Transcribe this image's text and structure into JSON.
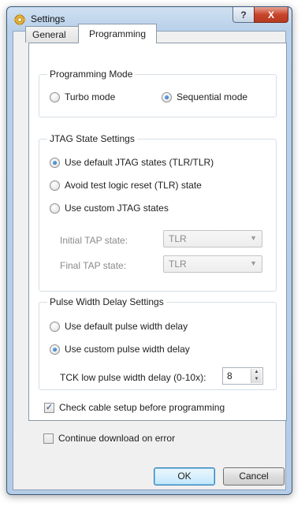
{
  "window": {
    "title": "Settings",
    "help_label": "?",
    "close_label": "X"
  },
  "tabs": [
    {
      "label": "General",
      "selected": false
    },
    {
      "label": "Programming",
      "selected": true
    }
  ],
  "programming_mode": {
    "title": "Programming Mode",
    "options": [
      {
        "label": "Turbo mode",
        "checked": false
      },
      {
        "label": "Sequential mode",
        "checked": true
      }
    ]
  },
  "jtag": {
    "title": "JTAG State Settings",
    "options": [
      {
        "label": "Use default JTAG states (TLR/TLR)",
        "checked": true
      },
      {
        "label": "Avoid test logic reset (TLR) state",
        "checked": false
      },
      {
        "label": "Use custom JTAG states",
        "checked": false
      }
    ],
    "initial_label": "Initial TAP state:",
    "initial_value": "TLR",
    "final_label": "Final TAP state:",
    "final_value": "TLR"
  },
  "pulse": {
    "title": "Pulse Width Delay Settings",
    "options": [
      {
        "label": "Use default pulse width delay",
        "checked": false
      },
      {
        "label": "Use custom pulse width delay",
        "checked": true
      }
    ],
    "tck_label": "TCK low pulse width delay (0-10x):",
    "tck_value": "8"
  },
  "checkboxes": [
    {
      "label": "Check cable setup before programming",
      "checked": true
    },
    {
      "label": "Continue download on error",
      "checked": false
    }
  ],
  "buttons": {
    "ok": "OK",
    "cancel": "Cancel"
  },
  "colors": {
    "title_bar": "#b9d1ea",
    "close_button": "#c7452b",
    "radio_dot": "#1a5fb4"
  }
}
